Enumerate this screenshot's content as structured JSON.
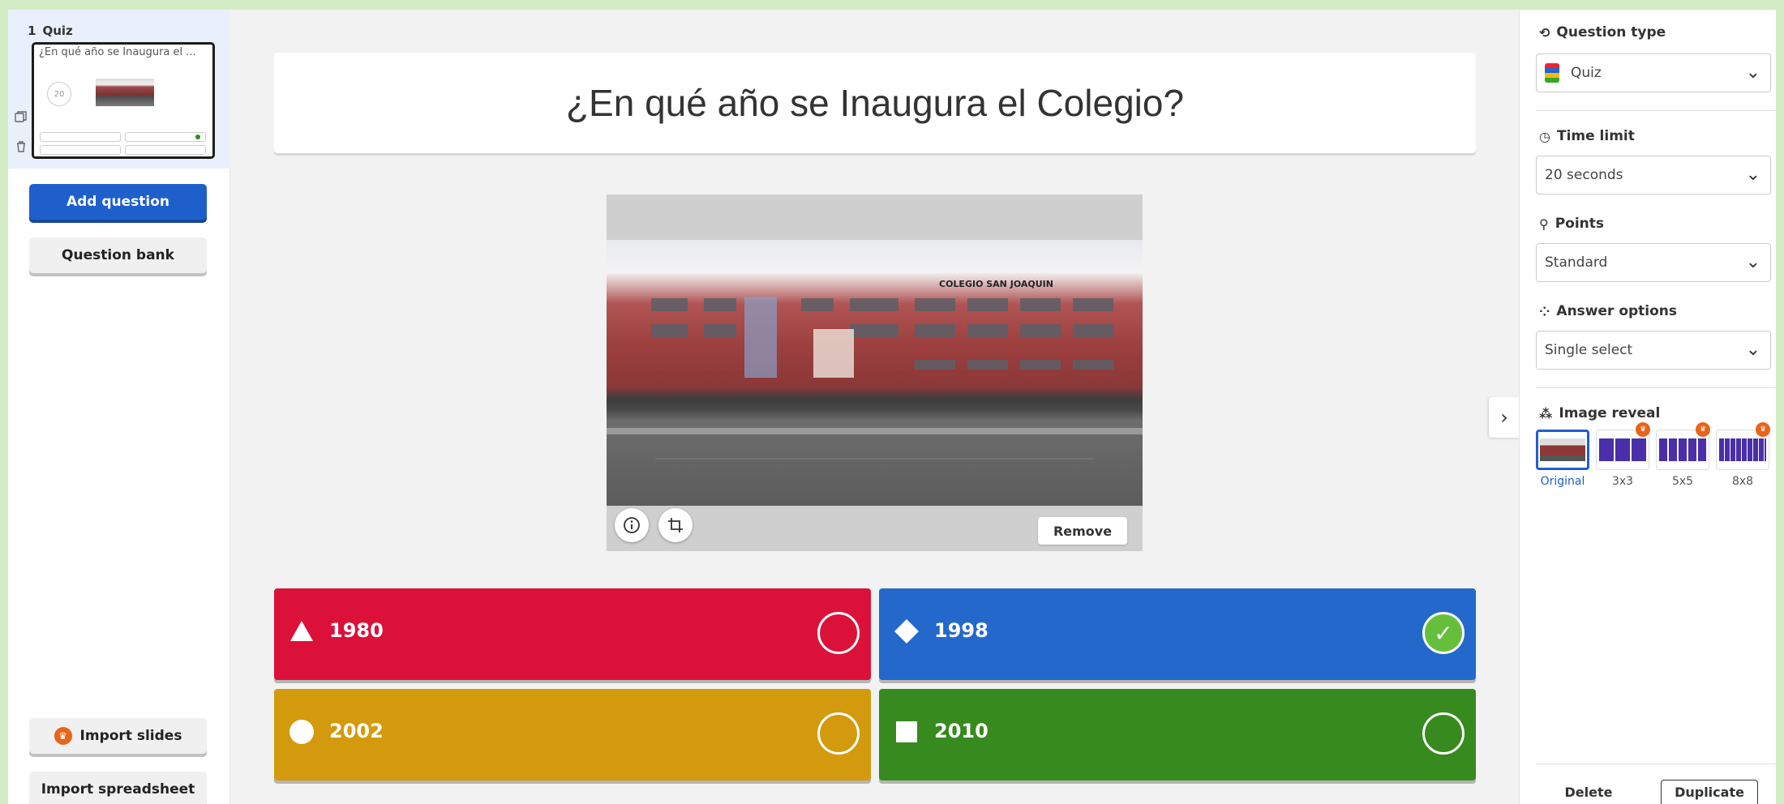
{
  "slide": {
    "number": "1",
    "type_label": "Quiz",
    "thumb_title": "¿En qué año se Inaugura el ...",
    "thumb_timer": "20"
  },
  "sidebar": {
    "add_question": "Add question",
    "question_bank": "Question bank",
    "import_slides": "Import slides",
    "import_spreadsheet": "Import spreadsheet"
  },
  "question": {
    "title": "¿En qué año se Inaugura el Colegio?",
    "media_remove": "Remove",
    "photo_sign": "COLEGIO SAN JOAQUIN"
  },
  "answers": [
    {
      "text": "1980",
      "color": "#dc1139",
      "shape": "triangle",
      "correct": false
    },
    {
      "text": "1998",
      "color": "#2468cc",
      "shape": "diamond",
      "correct": true
    },
    {
      "text": "2002",
      "color": "#d49a0d",
      "shape": "circle",
      "correct": false
    },
    {
      "text": "2010",
      "color": "#378a1e",
      "shape": "square",
      "correct": false
    }
  ],
  "right_panel": {
    "question_type_label": "Question type",
    "question_type_value": "Quiz",
    "time_limit_label": "Time limit",
    "time_limit_value": "20 seconds",
    "points_label": "Points",
    "points_value": "Standard",
    "answer_options_label": "Answer options",
    "answer_options_value": "Single select",
    "image_reveal_label": "Image reveal",
    "reveal_options": [
      "Original",
      "3x3",
      "5x5",
      "8x8"
    ],
    "delete": "Delete",
    "duplicate": "Duplicate"
  }
}
